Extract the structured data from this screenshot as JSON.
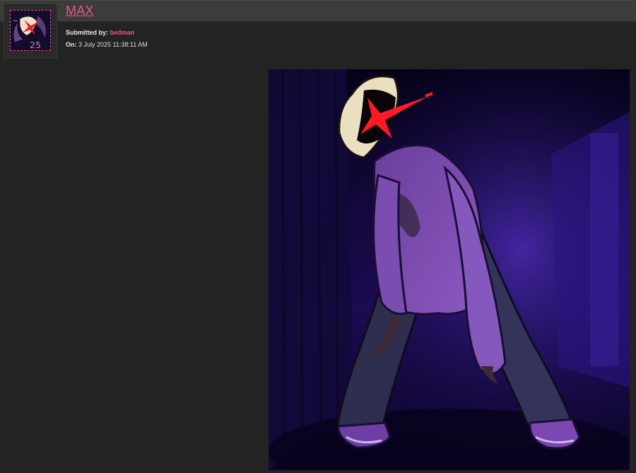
{
  "post": {
    "title": "MAX",
    "submitted_label": "Submitted by:",
    "submitter": "bedman",
    "date_label": "On:",
    "date": "3 July 2025 11:38:11 AM"
  },
  "colors": {
    "background": "#232323",
    "topbar": "#3c3c3c",
    "link": "#e6578f",
    "avatar_border": "#d6569a"
  },
  "icons": {
    "avatar": "user-avatar-image",
    "artwork": "submission-image"
  }
}
